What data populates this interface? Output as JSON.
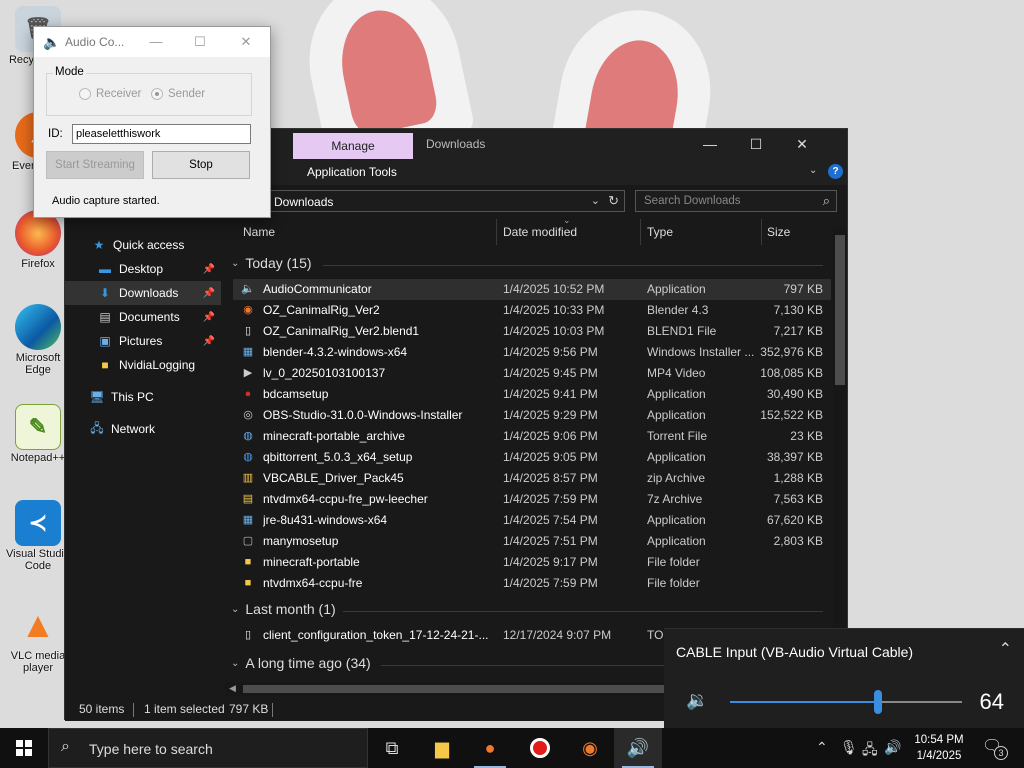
{
  "desktop": {
    "icons": [
      {
        "label": "Recycle Bin"
      },
      {
        "label": "Everything"
      },
      {
        "label": "Firefox"
      },
      {
        "label": "Microsoft Edge"
      },
      {
        "label": "Notepad++"
      },
      {
        "label": "Visual Studio Code"
      },
      {
        "label": "VLC media player"
      }
    ]
  },
  "audio_dialog": {
    "title": "Audio Co...",
    "mode_label": "Mode",
    "receiver_label": "Receiver",
    "sender_label": "Sender",
    "selected_mode": "Sender",
    "id_label": "ID:",
    "id_value": "pleaseletthiswork",
    "start_label": "Start Streaming",
    "stop_label": "Stop",
    "status": "Audio capture started."
  },
  "explorer": {
    "manage_tab": "Manage",
    "window_title": "Downloads",
    "ribbon_partial": "w",
    "ribbon_app_tools": "Application Tools",
    "address": "Downloads",
    "search_placeholder": "Search Downloads",
    "nav": [
      {
        "label": "Quick access",
        "icon": "star-icon"
      },
      {
        "label": "Desktop",
        "icon": "desktop-icon",
        "pinned": true
      },
      {
        "label": "Downloads",
        "icon": "download-arrow-icon",
        "pinned": true,
        "selected": true
      },
      {
        "label": "Documents",
        "icon": "document-icon",
        "pinned": true
      },
      {
        "label": "Pictures",
        "icon": "picture-icon",
        "pinned": true
      },
      {
        "label": "NvidiaLogging",
        "icon": "folder-icon"
      },
      {
        "label": "This PC",
        "icon": "computer-icon"
      },
      {
        "label": "Network",
        "icon": "network-icon"
      }
    ],
    "columns": {
      "name": "Name",
      "date": "Date modified",
      "type": "Type",
      "size": "Size"
    },
    "groups": {
      "today": "Today (15)",
      "last_month": "Last month (1)",
      "long_ago": "A long time ago (34)"
    },
    "files_today": [
      {
        "name": "AudioCommunicator",
        "date": "1/4/2025 10:52 PM",
        "type": "Application",
        "size": "797 KB",
        "icon": "speaker-app-icon",
        "selected": true
      },
      {
        "name": "OZ_CanimalRig_Ver2",
        "date": "1/4/2025 10:33 PM",
        "type": "Blender 4.3",
        "size": "7,130 KB",
        "icon": "blender-icon"
      },
      {
        "name": "OZ_CanimalRig_Ver2.blend1",
        "date": "1/4/2025 10:03 PM",
        "type": "BLEND1 File",
        "size": "7,217 KB",
        "icon": "blank-file-icon"
      },
      {
        "name": "blender-4.3.2-windows-x64",
        "date": "1/4/2025 9:56 PM",
        "type": "Windows Installer ...",
        "size": "352,976 KB",
        "icon": "installer-icon"
      },
      {
        "name": "lv_0_20250103100137",
        "date": "1/4/2025 9:45 PM",
        "type": "MP4 Video",
        "size": "108,085 KB",
        "icon": "video-file-icon"
      },
      {
        "name": "bdcamsetup",
        "date": "1/4/2025 9:41 PM",
        "type": "Application",
        "size": "30,490 KB",
        "icon": "bandicam-icon"
      },
      {
        "name": "OBS-Studio-31.0.0-Windows-Installer",
        "date": "1/4/2025 9:29 PM",
        "type": "Application",
        "size": "152,522 KB",
        "icon": "obs-icon"
      },
      {
        "name": "minecraft-portable_archive",
        "date": "1/4/2025 9:06 PM",
        "type": "Torrent File",
        "size": "23 KB",
        "icon": "torrent-icon"
      },
      {
        "name": "qbittorrent_5.0.3_x64_setup",
        "date": "1/4/2025 9:05 PM",
        "type": "Application",
        "size": "38,397 KB",
        "icon": "qbittorrent-icon"
      },
      {
        "name": "VBCABLE_Driver_Pack45",
        "date": "1/4/2025 8:57 PM",
        "type": "zip Archive",
        "size": "1,288 KB",
        "icon": "zip-icon"
      },
      {
        "name": "ntvdmx64-ccpu-fre_pw-leecher",
        "date": "1/4/2025 7:59 PM",
        "type": "7z Archive",
        "size": "7,563 KB",
        "icon": "7z-icon"
      },
      {
        "name": "jre-8u431-windows-x64",
        "date": "1/4/2025 7:54 PM",
        "type": "Application",
        "size": "67,620 KB",
        "icon": "java-installer-icon"
      },
      {
        "name": "manymosetup",
        "date": "1/4/2025 7:51 PM",
        "type": "Application",
        "size": "2,803 KB",
        "icon": "generic-app-icon"
      },
      {
        "name": "minecraft-portable",
        "date": "1/4/2025 9:17 PM",
        "type": "File folder",
        "size": "",
        "icon": "folder-icon"
      },
      {
        "name": "ntvdmx64-ccpu-fre",
        "date": "1/4/2025 7:59 PM",
        "type": "File folder",
        "size": "",
        "icon": "folder-icon"
      }
    ],
    "files_last_month": [
      {
        "name": "client_configuration_token_17-12-24-21-...",
        "date": "12/17/2024 9:07 PM",
        "type": "TOK",
        "size": "",
        "icon": "blank-file-icon"
      }
    ],
    "status": {
      "items": "50 items",
      "selected": "1 item selected",
      "size": "797 KB"
    }
  },
  "volume": {
    "device": "CABLE Input (VB-Audio Virtual Cable)",
    "level": 64,
    "level_text": "64",
    "accent": "#3b8de0"
  },
  "taskbar": {
    "search_placeholder": "Type here to search",
    "time": "10:54 PM",
    "date": "1/4/2025",
    "notification_count": "3"
  }
}
